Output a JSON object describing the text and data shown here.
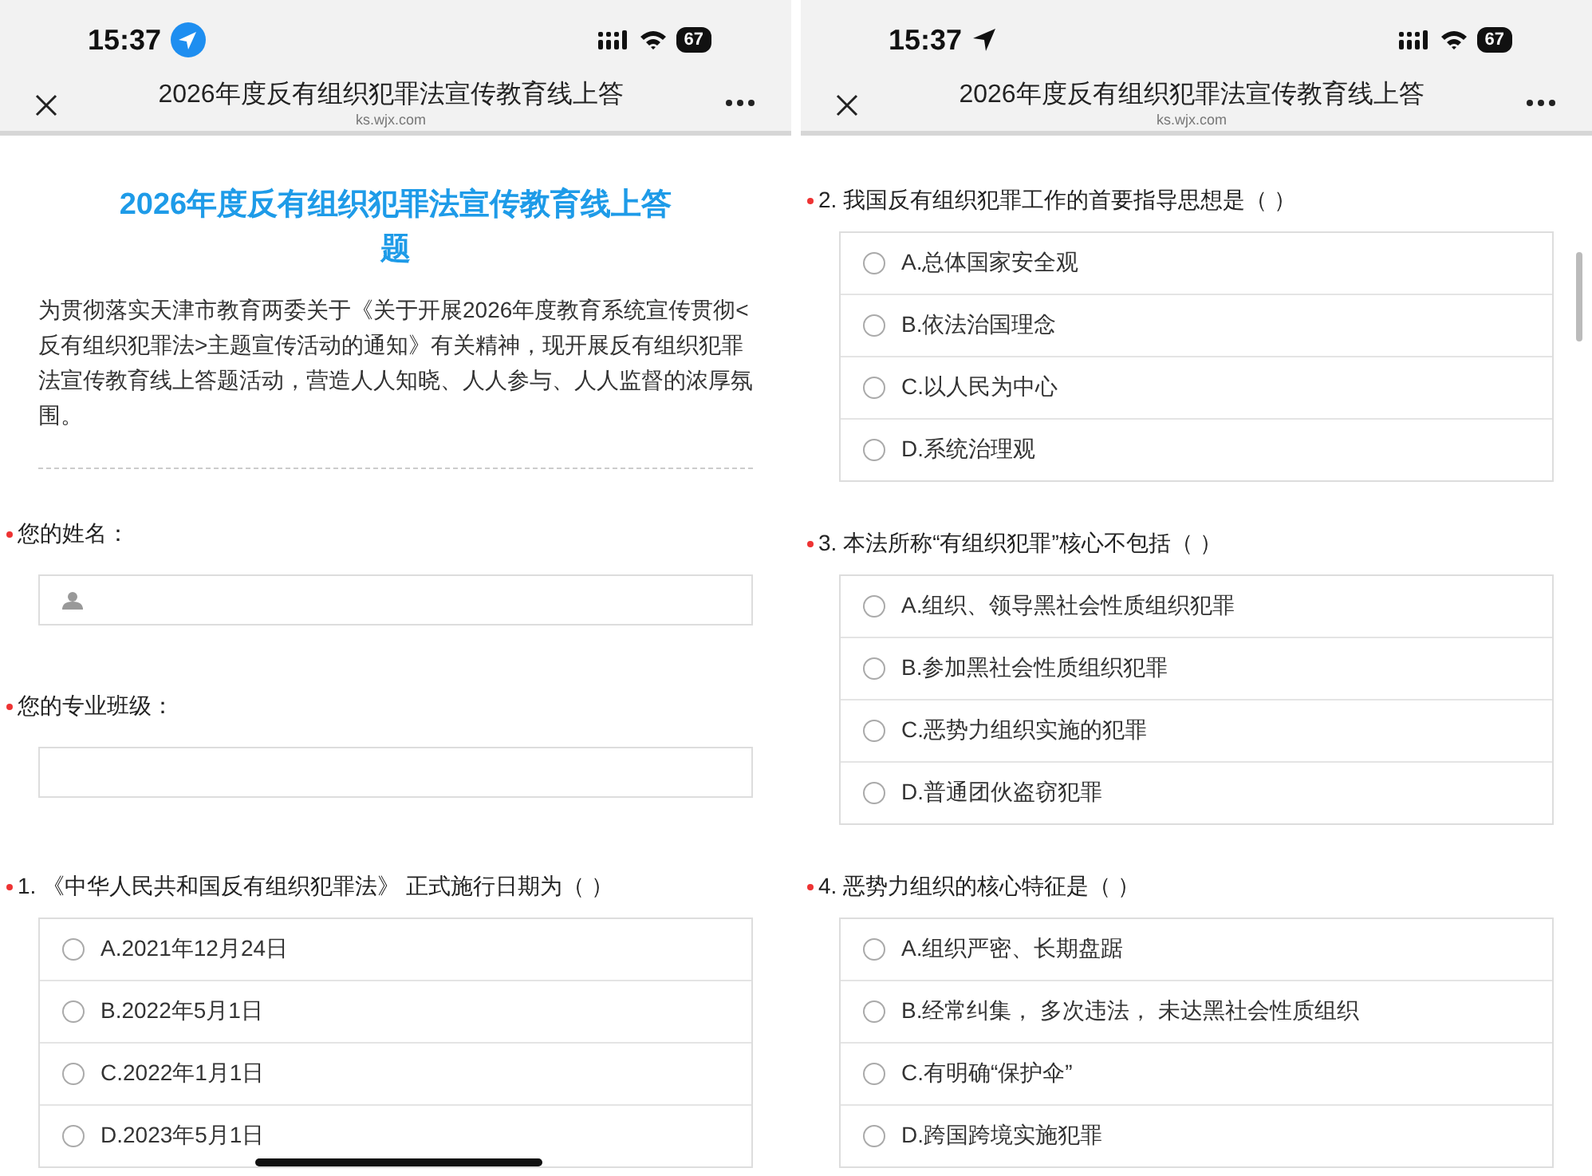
{
  "screens": [
    {
      "status_bar": {
        "time": "15:37",
        "location": {
          "kind": "badge"
        },
        "battery": "67"
      },
      "nav": {
        "title": "2026年度反有组织犯罪法宣传教育线上答",
        "domain": "ks.wjx.com"
      },
      "home_indicator": true,
      "header": {
        "title": "2026年度反有组织犯罪法宣传教育线上答题",
        "intro": "为贯彻落实天津市教育两委关于《关于开展2026年度教育系统宣传贯彻<反有组织犯罪法>主题宣传活动的通知》有关精神，现开展反有组织犯罪法宣传教育线上答题活动，营造人人知晓、人人参与、人人监督的浓厚氛围。"
      },
      "items": [
        {
          "kind": "field",
          "required": true,
          "label": "您的姓名：",
          "person_icon": true
        },
        {
          "kind": "field",
          "required": true,
          "label": "您的专业班级：",
          "person_icon": false
        },
        {
          "kind": "choice",
          "required": true,
          "label": "1. 《中华人民共和国反有组织犯罪法》 正式施行日期为（ ）",
          "options": [
            {
              "label": "A.2021年12月24日",
              "selected": false
            },
            {
              "label": "B.2022年5月1日",
              "selected": false
            },
            {
              "label": "C.2022年1月1日",
              "selected": false
            },
            {
              "label": "D.2023年5月1日",
              "selected": false
            }
          ]
        }
      ]
    },
    {
      "status_bar": {
        "time": "15:37",
        "location": {
          "kind": "plain"
        },
        "battery": "67"
      },
      "nav": {
        "title": "2026年度反有组织犯罪法宣传教育线上答",
        "domain": "ks.wjx.com"
      },
      "scrollbar": true,
      "items": [
        {
          "kind": "choice",
          "required": true,
          "label": "2. 我国反有组织犯罪工作的首要指导思想是（ ）",
          "options": [
            {
              "label": "A.总体国家安全观",
              "selected": false
            },
            {
              "label": "B.依法治国理念",
              "selected": false
            },
            {
              "label": "C.以人民为中心",
              "selected": false
            },
            {
              "label": "D.系统治理观",
              "selected": false
            }
          ]
        },
        {
          "kind": "choice",
          "required": true,
          "label": "3. 本法所称“有组织犯罪”核心不包括（ ）",
          "options": [
            {
              "label": "A.组织、领导黑社会性质组织犯罪",
              "selected": false
            },
            {
              "label": "B.参加黑社会性质组织犯罪",
              "selected": false
            },
            {
              "label": "C.恶势力组织实施的犯罪",
              "selected": false
            },
            {
              "label": "D.普通团伙盗窃犯罪",
              "selected": false
            }
          ]
        },
        {
          "kind": "choice",
          "required": true,
          "label": "4. 恶势力组织的核心特征是（ ）",
          "options": [
            {
              "label": "A.组织严密、长期盘踞",
              "selected": false
            },
            {
              "label": "B.经常纠集， 多次违法， 未达黑社会性质组织",
              "selected": false
            },
            {
              "label": "C.有明确“保护伞”",
              "selected": false
            },
            {
              "label": "D.跨国跨境实施犯罪",
              "selected": false
            }
          ]
        }
      ]
    }
  ]
}
